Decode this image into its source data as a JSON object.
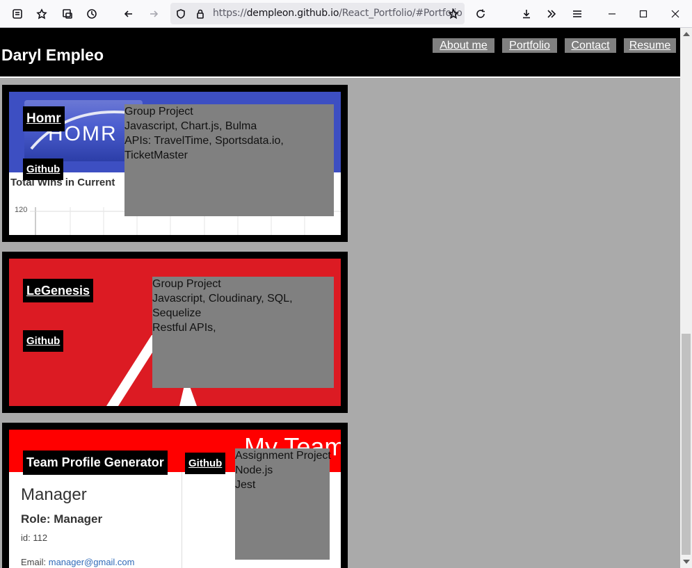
{
  "browser": {
    "url_prefix": "https://",
    "url_host": "dempleon.github.io",
    "url_path": "/React_Portfolio/#Portfolio",
    "icons": [
      "view-icon",
      "pocket-icon",
      "screenshot-icon",
      "history-icon",
      "back-icon",
      "forward-icon",
      "shield-icon",
      "lock-icon",
      "bookmark-star-icon",
      "reload-icon",
      "download-icon",
      "overflow-icon",
      "menu-icon",
      "minimize-icon",
      "maximize-icon",
      "close-icon"
    ]
  },
  "header": {
    "title": "Daryl Empleo",
    "nav": [
      {
        "label": "About me"
      },
      {
        "label": "Portfolio"
      },
      {
        "label": "Contact"
      },
      {
        "label": "Resume"
      }
    ]
  },
  "projects": [
    {
      "name": "Homr",
      "repo_label": "Github",
      "logo_text": "HOMR",
      "chart_title": "Total Wins in Current",
      "chart_tick": "120",
      "description": [
        "Group Project",
        "Javascript, Chart.js, Bulma",
        "APIs: TravelTime, Sportsdata.io,",
        "TicketMaster"
      ]
    },
    {
      "name": "LeGenesis",
      "repo_label": "Github",
      "description": [
        "Group Project",
        "Javascript, Cloudinary, SQL,",
        "Sequelize",
        "Restful APIs,"
      ]
    },
    {
      "name": "Team Profile Generator",
      "repo_label": "Github",
      "banner_text": "My Team",
      "profile_name": "Manager",
      "profile_role": "Role: Manager",
      "profile_id": "id: 112",
      "profile_email_label": "Email:",
      "profile_email": "manager@gmail.com",
      "description": [
        "Assignment Project",
        "Node.js",
        "Jest"
      ]
    }
  ],
  "colors": {
    "page_bg": "#aaaaaa",
    "header_bg": "#000000",
    "nav_bg": "#808080",
    "homr_blue": "#3d4fc2",
    "legenesis_red": "#dc1b23",
    "team_red": "#ff0000"
  }
}
